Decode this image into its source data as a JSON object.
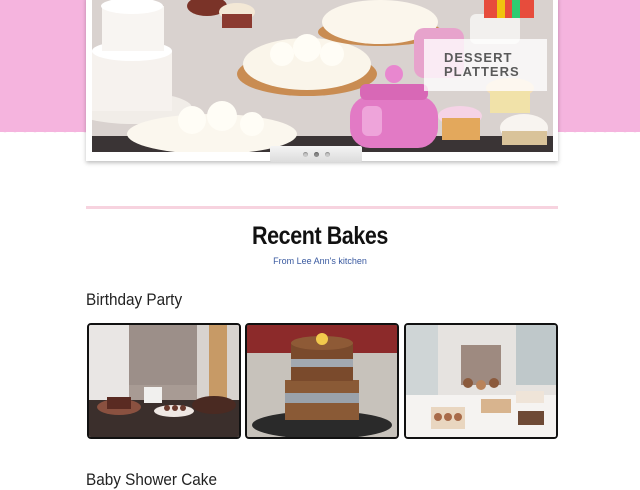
{
  "hero": {
    "caption_line1": "DESSERT",
    "caption_line2": "PLATTERS",
    "pager_dots": 3,
    "active_dot": 2
  },
  "recent": {
    "title": "Recent Bakes",
    "subtitle": "From Lee Ann's kitchen"
  },
  "albums": [
    {
      "title": "Birthday Party",
      "photo_count": 3
    },
    {
      "title": "Baby Shower Cake"
    }
  ],
  "colors": {
    "pink_band": "#f5b4de",
    "divider": "#f7d3df",
    "subtitle_link": "#3a5aa0"
  }
}
